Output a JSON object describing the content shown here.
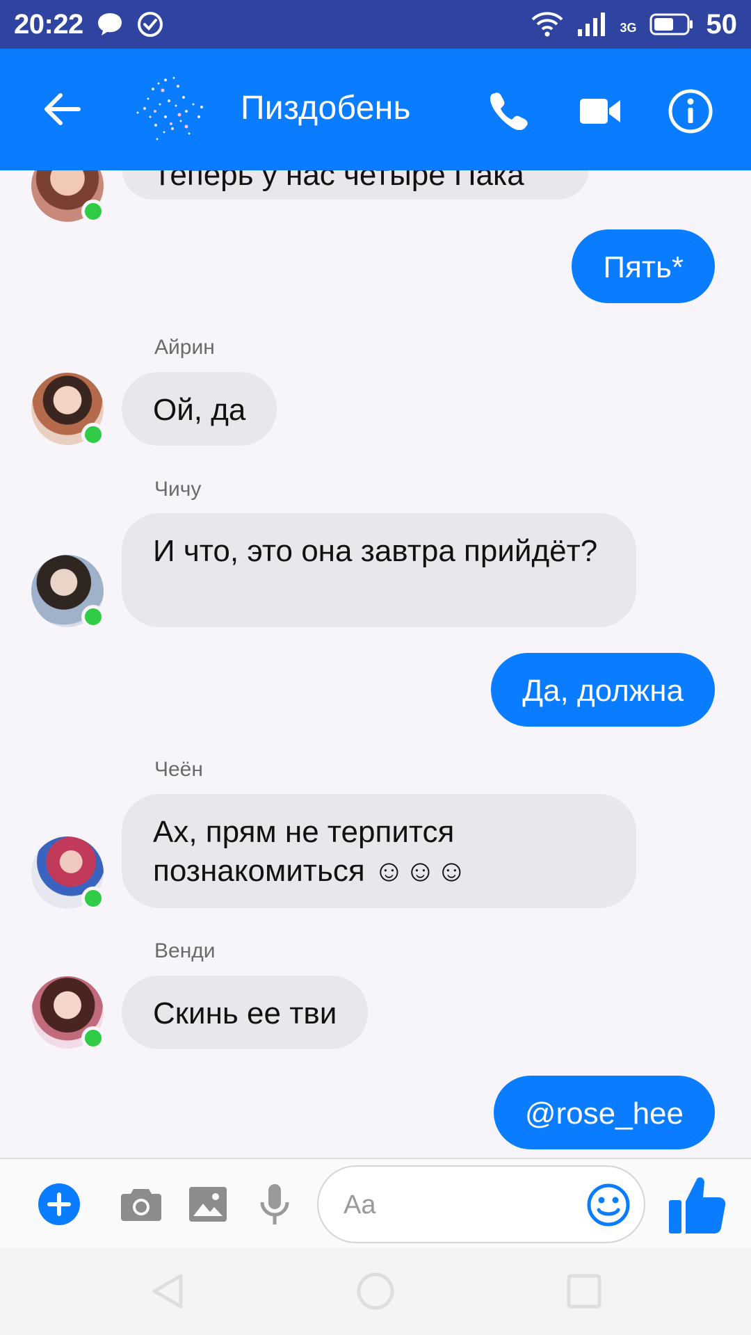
{
  "status_bar": {
    "time": "20:22",
    "network_type": "3G",
    "battery": "50"
  },
  "header": {
    "title": "Пиздобень"
  },
  "messages": [
    {
      "direction": "in",
      "text": "Теперь у нас четыре Пака"
    },
    {
      "direction": "out",
      "text": "Пять*"
    },
    {
      "direction": "in",
      "sender": "Айрин",
      "text": "Ой, да"
    },
    {
      "direction": "in",
      "sender": "Чичу",
      "text": "И что, это она завтра прийдёт?"
    },
    {
      "direction": "out",
      "text": "Да, должна"
    },
    {
      "direction": "in",
      "sender": "Чеён",
      "text": "Ах, прям не терпится познакомиться ☺☺☺"
    },
    {
      "direction": "in",
      "sender": "Венди",
      "text": "Скинь ее тви"
    },
    {
      "direction": "out",
      "text": "@rose_hee"
    }
  ],
  "composer": {
    "placeholder": "Aa"
  },
  "colors": {
    "accent": "#0a7cff",
    "status_bar": "#2f44a0",
    "incoming_bubble": "#e9e7ec",
    "online": "#31cc46"
  },
  "icons": {
    "back": "arrow-left-icon",
    "call": "phone-icon",
    "video": "video-camera-icon",
    "info": "info-icon",
    "add": "plus-circle-icon",
    "camera": "camera-icon",
    "gallery": "image-icon",
    "voice": "microphone-icon",
    "emoji": "smiley-icon",
    "like": "thumbs-up-icon"
  }
}
